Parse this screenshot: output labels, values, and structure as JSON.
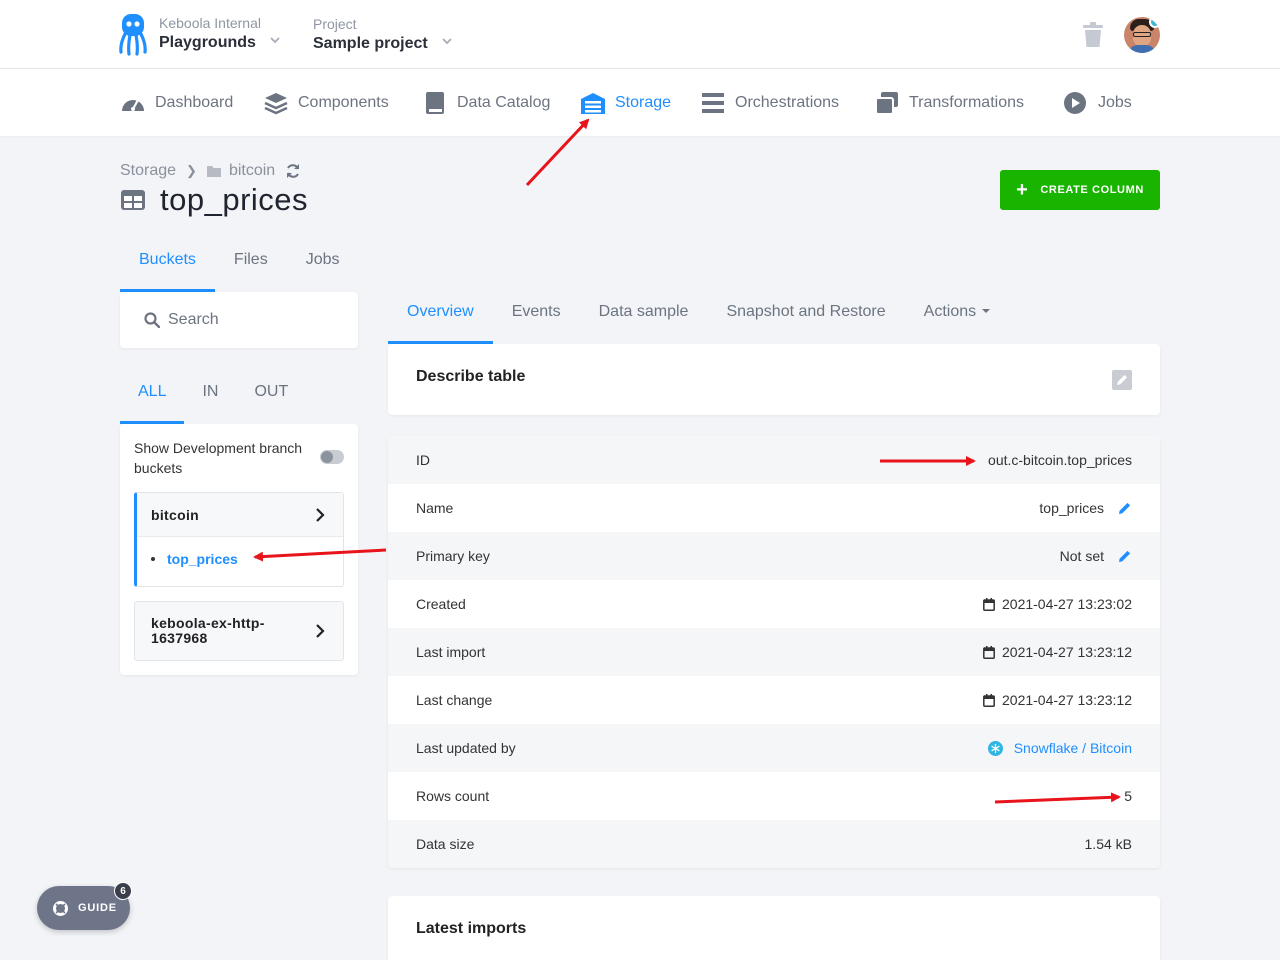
{
  "header": {
    "org_label": "Keboola Internal",
    "org_value": "Playgrounds",
    "project_label": "Project",
    "project_value": "Sample project"
  },
  "nav": {
    "items": [
      {
        "label": "Dashboard",
        "icon": "gauge-icon"
      },
      {
        "label": "Components",
        "icon": "layers-icon"
      },
      {
        "label": "Data Catalog",
        "icon": "book-icon"
      },
      {
        "label": "Storage",
        "icon": "storage-icon",
        "active": true
      },
      {
        "label": "Orchestrations",
        "icon": "bars-icon"
      },
      {
        "label": "Transformations",
        "icon": "windows-icon"
      },
      {
        "label": "Jobs",
        "icon": "play-icon"
      }
    ]
  },
  "breadcrumb": {
    "root": "Storage",
    "bucket": "bitcoin"
  },
  "page": {
    "title": "top_prices",
    "create_button": "CREATE COLUMN"
  },
  "left_tabs": [
    "Buckets",
    "Files",
    "Jobs"
  ],
  "search": {
    "placeholder": "Search"
  },
  "filter_tabs": [
    "ALL",
    "IN",
    "OUT"
  ],
  "sidebar": {
    "dev_branch_label": "Show Development branch buckets",
    "buckets": [
      {
        "name": "bitcoin",
        "tables": [
          "top_prices"
        ]
      },
      {
        "name": "keboola-ex-http-1637968"
      }
    ]
  },
  "right_tabs": [
    "Overview",
    "Events",
    "Data sample",
    "Snapshot and Restore",
    "Actions"
  ],
  "describe": {
    "label": "Describe table"
  },
  "details": {
    "id": {
      "label": "ID",
      "value": "out.c-bitcoin.top_prices"
    },
    "name": {
      "label": "Name",
      "value": "top_prices"
    },
    "primary_key": {
      "label": "Primary key",
      "value": "Not set"
    },
    "created": {
      "label": "Created",
      "value": "2021-04-27 13:23:02"
    },
    "last_import": {
      "label": "Last import",
      "value": "2021-04-27 13:23:12"
    },
    "last_change": {
      "label": "Last change",
      "value": "2021-04-27 13:23:12"
    },
    "last_updated_by": {
      "label": "Last updated by",
      "value": "Snowflake / Bitcoin"
    },
    "rows_count": {
      "label": "Rows count",
      "value": "5"
    },
    "data_size": {
      "label": "Data size",
      "value": "1.54 kB"
    }
  },
  "latest_imports": {
    "label": "Latest imports"
  },
  "guide": {
    "label": "GUIDE",
    "badge": "6"
  },
  "colors": {
    "accent": "#1f8fff",
    "create": "#19b400",
    "annotation": "#e8131b"
  }
}
